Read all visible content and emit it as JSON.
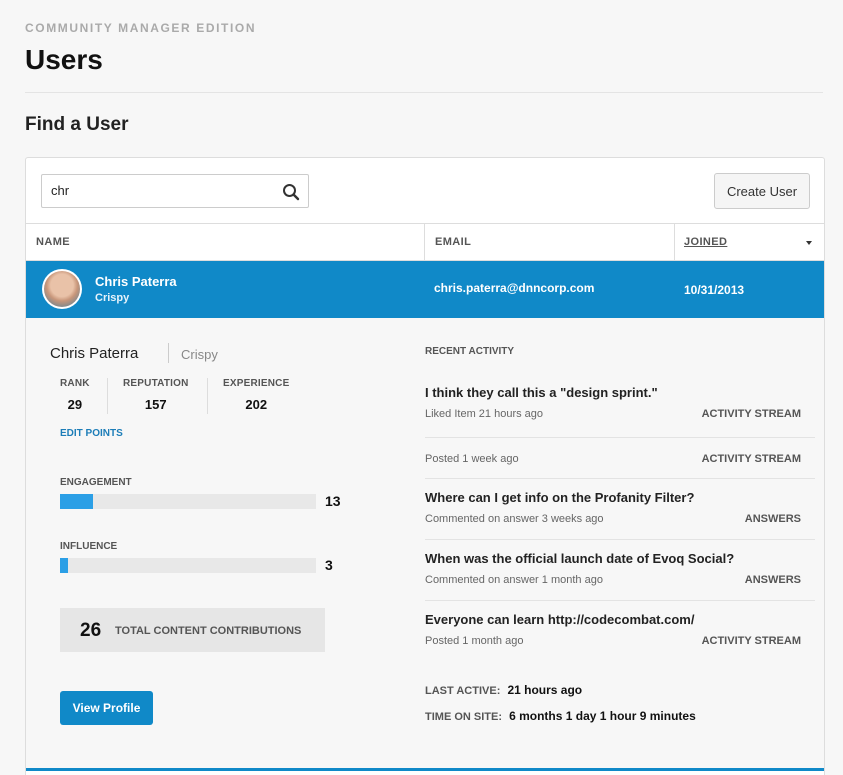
{
  "header": {
    "edition": "COMMUNITY MANAGER EDITION",
    "title": "Users",
    "section_title": "Find a User"
  },
  "search": {
    "value": "chr",
    "icon": "search-icon"
  },
  "toolbar": {
    "create_user_label": "Create User"
  },
  "table": {
    "columns": {
      "name": "NAME",
      "email": "EMAIL",
      "joined": "JOINED"
    },
    "sort_column": "joined",
    "rows": [
      {
        "name": "Chris Paterra",
        "handle": "Crispy",
        "email": "chris.paterra@dnncorp.com",
        "joined": "10/31/2013"
      }
    ]
  },
  "details": {
    "name": "Chris Paterra",
    "handle": "Crispy",
    "stats": [
      {
        "label": "RANK",
        "value": "29"
      },
      {
        "label": "REPUTATION",
        "value": "157"
      },
      {
        "label": "EXPERIENCE",
        "value": "202"
      }
    ],
    "edit_points_label": "EDIT POINTS",
    "meters": [
      {
        "label": "ENGAGEMENT",
        "value": "13",
        "fill_fraction": 0.13
      },
      {
        "label": "INFLUENCE",
        "value": "3",
        "fill_fraction": 0.03
      }
    ],
    "contributions": {
      "count": "26",
      "label": "TOTAL CONTENT CONTRIBUTIONS"
    },
    "view_profile_label": "View Profile"
  },
  "activity": {
    "heading": "RECENT ACTIVITY",
    "items": [
      {
        "title": "I think they call this a \"design sprint.\"",
        "meta": "Liked Item 21 hours ago",
        "source": "ACTIVITY STREAM"
      },
      {
        "title": "",
        "meta": "Posted 1 week ago",
        "source": "ACTIVITY STREAM"
      },
      {
        "title": "Where can I get info on the Profanity Filter?",
        "meta": "Commented on answer 3 weeks ago",
        "source": "ANSWERS"
      },
      {
        "title": "When was the official launch date of Evoq Social?",
        "meta": "Commented on answer 1 month ago",
        "source": "ANSWERS"
      },
      {
        "title": "Everyone can learn http://codecombat.com/",
        "meta": "Posted 1 month ago",
        "source": "ACTIVITY STREAM"
      }
    ],
    "last_active_label": "LAST ACTIVE:",
    "last_active_value": "21 hours ago",
    "time_on_site_label": "TIME ON SITE:",
    "time_on_site_value": "6 months 1 day 1 hour 9 minutes"
  },
  "colors": {
    "accent": "#1089c8",
    "meter_fill": "#2b9fe6"
  }
}
